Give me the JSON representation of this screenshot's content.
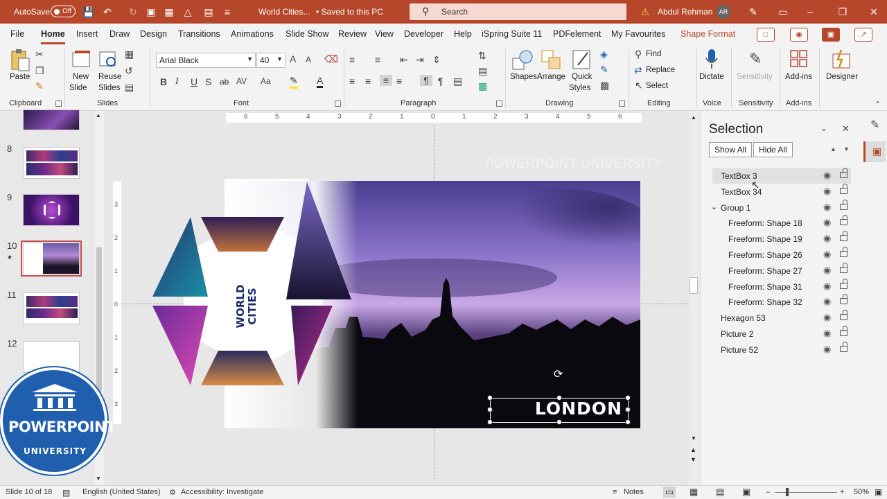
{
  "title_bar": {
    "autosave_label": "AutoSave",
    "autosave_state": "Off",
    "document_title": "World Cities...",
    "save_status": "• Saved to this PC",
    "search_placeholder": "Search",
    "user_name": "Abdul Rehman",
    "user_initials": "AR"
  },
  "menu_tabs": [
    "File",
    "Home",
    "Insert",
    "Draw",
    "Design",
    "Transitions",
    "Animations",
    "Slide Show",
    "Review",
    "View",
    "Developer",
    "Help",
    "iSpring Suite 11",
    "PDFelement",
    "My Favourites",
    "Shape Format"
  ],
  "active_tab": "Home",
  "ribbon": {
    "clipboard": {
      "group": "Clipboard",
      "paste": "Paste"
    },
    "slides": {
      "group": "Slides",
      "new_slide_1": "New",
      "new_slide_2": "Slide",
      "reuse_1": "Reuse",
      "reuse_2": "Slides"
    },
    "font": {
      "group": "Font",
      "family": "Arial Black",
      "size": "40",
      "bold": "B",
      "italic": "I",
      "underline": "U",
      "strike": "ab",
      "spacing": "AV",
      "case": "Aa",
      "grow": "A",
      "shrink": "A"
    },
    "paragraph": {
      "group": "Paragraph"
    },
    "drawing": {
      "group": "Drawing",
      "shapes": "Shapes",
      "arrange": "Arrange",
      "quick_styles_1": "Quick",
      "quick_styles_2": "Styles"
    },
    "editing": {
      "group": "Editing",
      "find": "Find",
      "replace": "Replace",
      "select": "Select"
    },
    "voice": {
      "group": "Voice",
      "dictate": "Dictate"
    },
    "sensitivity": {
      "group": "Sensitivity",
      "button": "Sensitivity"
    },
    "addins": {
      "group": "Add-ins",
      "button": "Add-ins"
    },
    "designer": {
      "button": "Designer"
    }
  },
  "thumbnails": [
    {
      "number": "8"
    },
    {
      "number": "9"
    },
    {
      "number": "10"
    },
    {
      "number": "11"
    },
    {
      "number": "12"
    }
  ],
  "ruler_ticks": [
    "6",
    "5",
    "4",
    "3",
    "2",
    "1",
    "0",
    "1",
    "2",
    "3",
    "4",
    "5",
    "6"
  ],
  "ruler_v_ticks": [
    "3",
    "2",
    "1",
    "0",
    "1",
    "2",
    "3"
  ],
  "slide": {
    "title_line1": "WORLD",
    "title_line2": "CITIES",
    "city": "LONDON",
    "watermark": "POWERPOINT UNIVERSITY"
  },
  "selection_pane": {
    "title": "Selection",
    "show_all": "Show All",
    "hide_all": "Hide All",
    "items": [
      {
        "label": "TextBox 3",
        "indent": 0,
        "selected": true
      },
      {
        "label": "TextBox 34",
        "indent": 0
      },
      {
        "label": "Group 1",
        "indent": 0,
        "expanded": true
      },
      {
        "label": "Freeform: Shape 18",
        "indent": 1
      },
      {
        "label": "Freeform: Shape 19",
        "indent": 1
      },
      {
        "label": "Freeform: Shape 26",
        "indent": 1
      },
      {
        "label": "Freeform: Shape 27",
        "indent": 1
      },
      {
        "label": "Freeform: Shape 31",
        "indent": 1
      },
      {
        "label": "Freeform: Shape 32",
        "indent": 1
      },
      {
        "label": "Hexagon 53",
        "indent": 0
      },
      {
        "label": "Picture 2",
        "indent": 0
      },
      {
        "label": "Picture 52",
        "indent": 0
      }
    ]
  },
  "logo": {
    "line1": "POWERPOINT",
    "line2": "UNIVERSITY"
  },
  "status_bar": {
    "slide_info": "Slide 10 of 18",
    "language": "English (United States)",
    "accessibility": "Accessibility: Investigate",
    "notes": "Notes",
    "zoom": "50%"
  },
  "colors": {
    "accent": "#b7472a",
    "selected_thumb": "#c0504d",
    "logo_blue": "#1f5fae",
    "title_navy": "#1a2a6c"
  }
}
